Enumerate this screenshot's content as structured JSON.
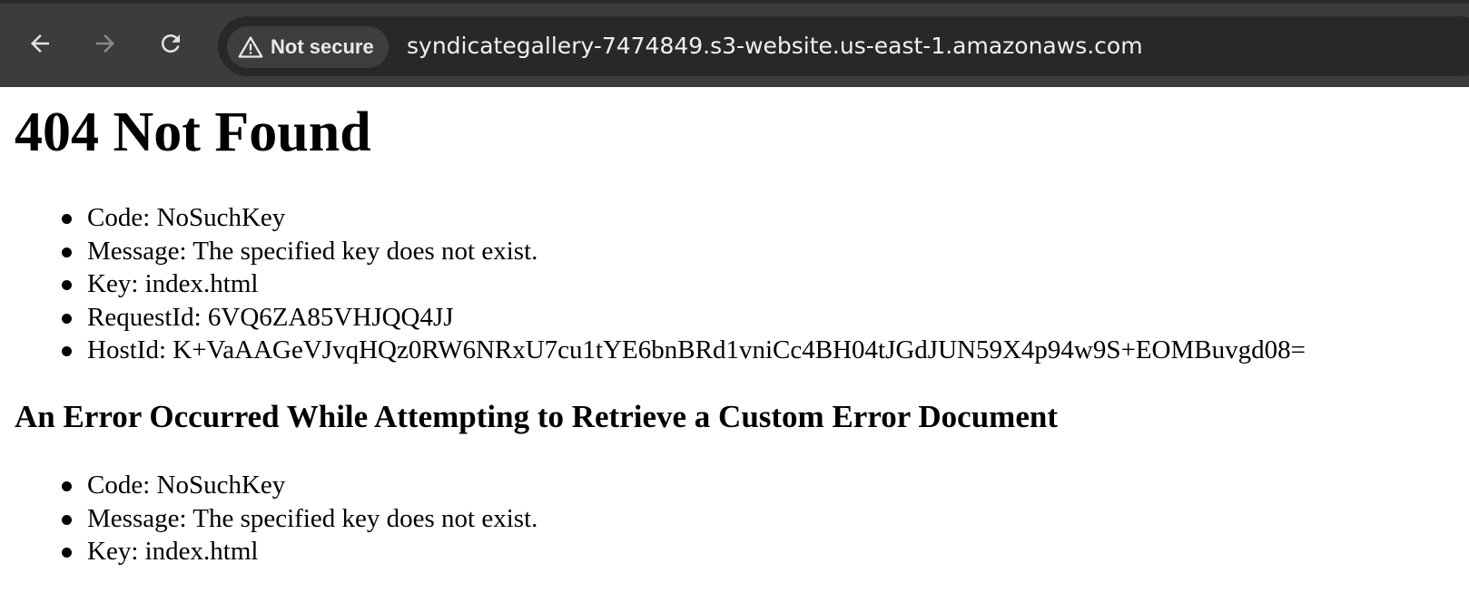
{
  "browser": {
    "security_label": "Not secure",
    "url": "syndicategallery-7474849.s3-website.us-east-1.amazonaws.com",
    "icons": {
      "back": "arrow-left-icon",
      "forward": "arrow-right-icon",
      "reload": "reload-icon",
      "security": "warning-triangle-icon"
    }
  },
  "page": {
    "title": "404 Not Found",
    "error_items": [
      "Code: NoSuchKey",
      "Message: The specified key does not exist.",
      "Key: index.html",
      "RequestId: 6VQ6ZA85VHJQQ4JJ",
      "HostId: K+VaAAGeVJvqHQz0RW6NRxU7cu1tYE6bnBRd1vniCc4BH04tJGdJUN59X4p94w9S+EOMBuvgd08="
    ],
    "custom_error_heading": "An Error Occurred While Attempting to Retrieve a Custom Error Document",
    "custom_error_items": [
      "Code: NoSuchKey",
      "Message: The specified key does not exist.",
      "Key: index.html"
    ]
  },
  "colors": {
    "toolbar_bg": "#3c3c3c",
    "omnibox_bg": "#282828",
    "chip_bg": "#3d3d3d",
    "page_bg": "#ffffff",
    "text": "#000000"
  }
}
